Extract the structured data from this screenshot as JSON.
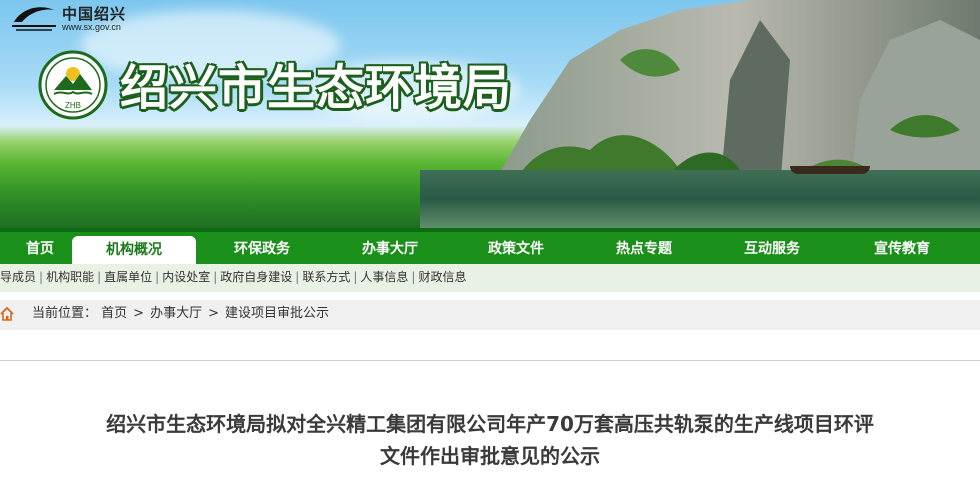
{
  "header": {
    "gov_name": "中国绍兴",
    "gov_url": "www.sx.gov.cn",
    "emblem_text": "ZHB",
    "site_title": "绍兴市生态环境局",
    "colors": {
      "title_stroke": "#1c5f1c",
      "nav_bg": "#1a8f1a",
      "nav_active_text": "#1a7a1a"
    }
  },
  "nav": {
    "items": [
      "首页",
      "机构概况",
      "环保政务",
      "办事大厅",
      "政策文件",
      "热点专题",
      "互动服务",
      "宣传教育"
    ],
    "active": "机构概况"
  },
  "subnav": {
    "items": [
      "领导成员",
      "机构职能",
      "直属单位",
      "内设处室",
      "政府自身建设",
      "联系方式",
      "人事信息",
      "财政信息"
    ],
    "separator": "|"
  },
  "breadcrumb": {
    "icon": "home-icon",
    "prefix": "当前位置：",
    "items": [
      "首页",
      "办事大厅",
      "建设项目审批公示"
    ],
    "arrow": ">"
  },
  "article": {
    "title_line1": "绍兴市生态环境局拟对全兴精工集团有限公司年产70万套高压共轨泵的生产线项目环评",
    "title_line2": "文件作出审批意见的公示"
  }
}
